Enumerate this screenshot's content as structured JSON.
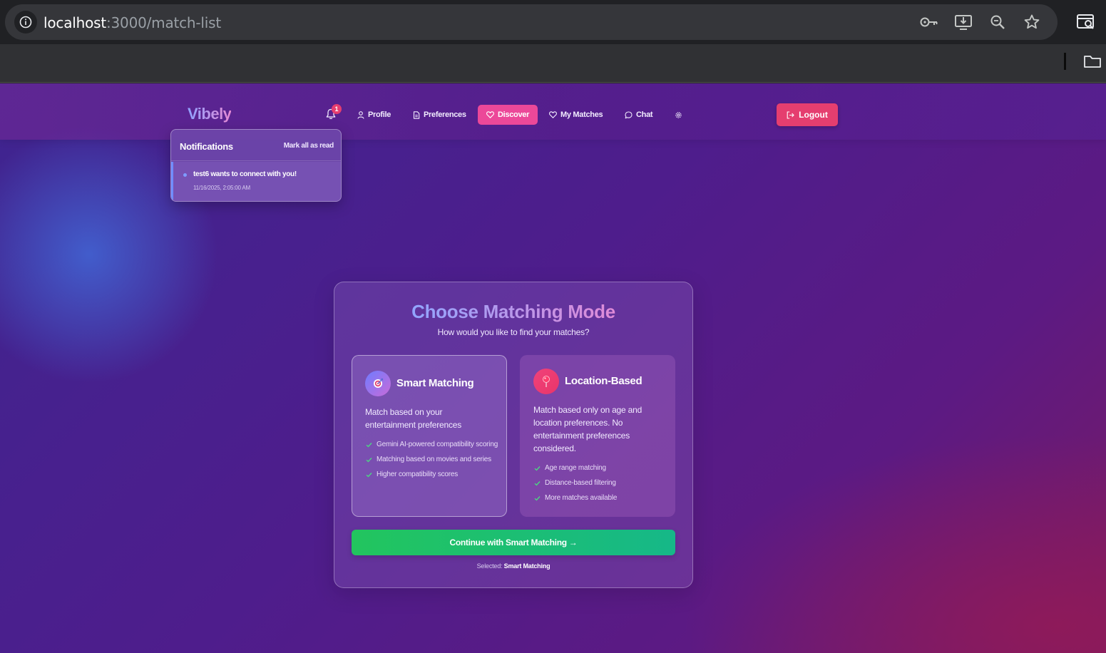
{
  "browser": {
    "url_host": "localhost",
    "url_path": ":3000/match-list"
  },
  "navbar": {
    "logo": "Vibely",
    "notification_count": "1",
    "items": [
      {
        "label": "Profile",
        "icon": "user-icon"
      },
      {
        "label": "Preferences",
        "icon": "document-icon"
      },
      {
        "label": "Discover",
        "icon": "heart-icon",
        "active": true
      },
      {
        "label": "My Matches",
        "icon": "heart-outline-icon"
      },
      {
        "label": "Chat",
        "icon": "chat-bubble-icon"
      }
    ],
    "settings_icon": "gear-icon",
    "logout_label": "Logout"
  },
  "notifications": {
    "title": "Notifications",
    "mark_all_label": "Mark all as read",
    "items": [
      {
        "message": "test6 wants to connect with you!",
        "time": "11/16/2025, 2:05:00 AM"
      }
    ]
  },
  "matching": {
    "title": "Choose Matching Mode",
    "subtitle": "How would you like to find your matches?",
    "options": [
      {
        "name": "Smart Matching",
        "icon": "target-icon",
        "description": "Match based on your entertainment preferences",
        "features": [
          "Gemini AI-powered compatibility scoring",
          "Matching based on movies and series",
          "Higher compatibility scores"
        ],
        "selected": true
      },
      {
        "name": "Location-Based",
        "icon": "map-pin-icon",
        "description": "Match based only on age and location preferences. No entertainment preferences considered.",
        "features": [
          "Age range matching",
          "Distance-based filtering",
          "More matches available"
        ],
        "selected": false
      }
    ],
    "continue_label": "Continue with Smart Matching →",
    "selected_prefix": "Selected:",
    "selected_value": "Smart Matching"
  },
  "colors": {
    "accent_pink": "#ec4899",
    "logout_red": "#e53e6f",
    "continue_green": "#22c55e",
    "check_green": "#4ade80"
  }
}
